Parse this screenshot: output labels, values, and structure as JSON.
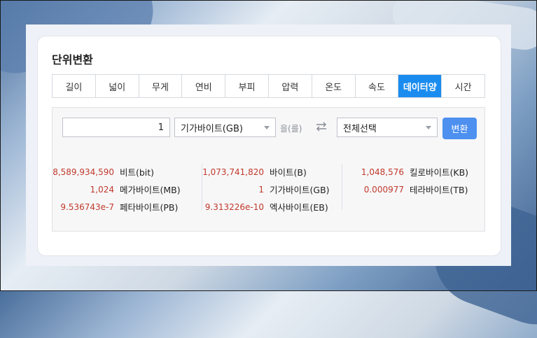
{
  "title": "단위변환",
  "tabs": [
    {
      "label": "길이",
      "active": false
    },
    {
      "label": "넓이",
      "active": false
    },
    {
      "label": "무게",
      "active": false
    },
    {
      "label": "연비",
      "active": false
    },
    {
      "label": "부피",
      "active": false
    },
    {
      "label": "압력",
      "active": false
    },
    {
      "label": "온도",
      "active": false
    },
    {
      "label": "속도",
      "active": false
    },
    {
      "label": "데이터양",
      "active": true
    },
    {
      "label": "시간",
      "active": false
    }
  ],
  "converter": {
    "input_value": "1",
    "from_unit": "기가바이트(GB)",
    "particle": "을(를)",
    "to_unit": "전체선택",
    "convert_label": "변환"
  },
  "results": {
    "col1": [
      {
        "value": "8,589,934,590",
        "unit": "비트(bit)"
      },
      {
        "value": "1,024",
        "unit": "메가바이트(MB)"
      },
      {
        "value": "9.536743e-7",
        "unit": "페타바이트(PB)"
      }
    ],
    "col2": [
      {
        "value": "1,073,741,820",
        "unit": "바이트(B)"
      },
      {
        "value": "1",
        "unit": "기가바이트(GB)"
      },
      {
        "value": "9.313226e-10",
        "unit": "엑사바이트(EB)"
      }
    ],
    "col3": [
      {
        "value": "1,048,576",
        "unit": "킬로바이트(KB)"
      },
      {
        "value": "0.000977",
        "unit": "테라바이트(TB)"
      }
    ]
  },
  "colors": {
    "accent": "#1a8cf0",
    "button": "#4d90f0",
    "value_red": "#c0392b"
  }
}
